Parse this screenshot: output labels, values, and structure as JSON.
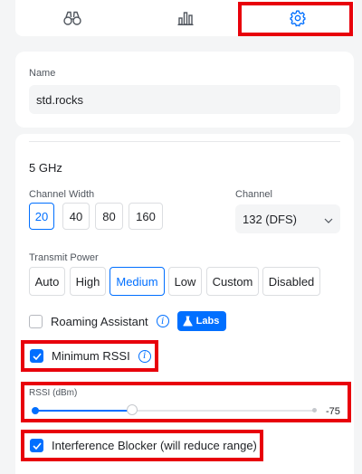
{
  "tabs": [
    {
      "name": "binoculars-icon"
    },
    {
      "name": "bar-chart-icon"
    },
    {
      "name": "gear-icon",
      "active": true
    }
  ],
  "name_section": {
    "label": "Name",
    "value": "std.rocks"
  },
  "radio": {
    "band": "5 GHz",
    "channel_width": {
      "label": "Channel Width",
      "options": [
        "20",
        "40",
        "80",
        "160"
      ],
      "selected": "20"
    },
    "channel": {
      "label": "Channel",
      "value": "132 (DFS)"
    },
    "transmit_power": {
      "label": "Transmit Power",
      "options": [
        "Auto",
        "High",
        "Medium",
        "Low",
        "Custom",
        "Disabled"
      ],
      "selected": "Medium"
    },
    "roaming_assistant": {
      "label": "Roaming Assistant",
      "checked": false,
      "badge": "Labs"
    },
    "minimum_rssi": {
      "label": "Minimum RSSI",
      "checked": true
    },
    "rssi": {
      "label": "RSSI (dBm)",
      "value": "-75",
      "slider_fraction": 0.35
    },
    "interference_blocker": {
      "label": "Interference Blocker (will reduce range)",
      "checked": true
    }
  },
  "colors": {
    "accent": "#006fff",
    "highlight": "#e8000b"
  }
}
